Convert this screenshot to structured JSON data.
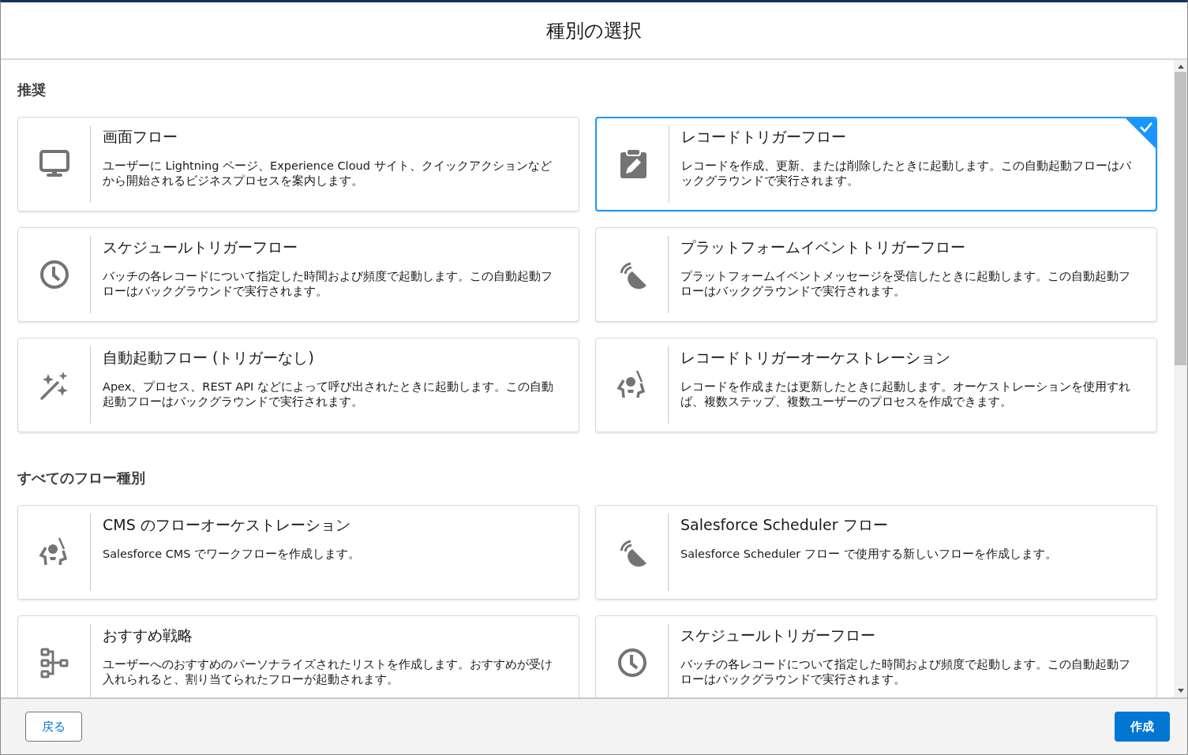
{
  "modal": {
    "title": "種別の選択"
  },
  "sections": [
    {
      "heading": "推奨",
      "cards": [
        {
          "kind": "monitor",
          "title": "画面フロー",
          "description": "ユーザーに Lightning ページ、Experience Cloud サイト、クイックアクションなどから開始されるビジネスプロセスを案内します。",
          "selected": false
        },
        {
          "kind": "clipboard",
          "title": "レコードトリガーフロー",
          "description": "レコードを作成、更新、または削除したときに起動します。この自動起動フローはバックグラウンドで実行されます。",
          "selected": true
        },
        {
          "kind": "clock",
          "title": "スケジュールトリガーフロー",
          "description": "バッチの各レコードについて指定した時間および頻度で起動します。この自動起動フローはバックグラウンドで実行されます。",
          "selected": false
        },
        {
          "kind": "signal",
          "title": "プラットフォームイベントトリガーフロー",
          "description": "プラットフォームイベントメッセージを受信したときに起動します。この自動起動フローはバックグラウンドで実行されます。",
          "selected": false
        },
        {
          "kind": "wand",
          "title": "自動起動フロー (トリガーなし)",
          "description": "Apex、プロセス、REST API などによって呼び出されたときに起動します。この自動起動フローはバックグラウンドで実行されます。",
          "selected": false
        },
        {
          "kind": "conductor",
          "title": "レコードトリガーオーケストレーション",
          "description": "レコードを作成または更新したときに起動します。オーケストレーションを使用すれば、複数ステップ、複数ユーザーのプロセスを作成できます。",
          "selected": false
        }
      ]
    },
    {
      "heading": "すべてのフロー種別",
      "cards": [
        {
          "kind": "conductor",
          "title": "CMS のフローオーケストレーション",
          "description": "Salesforce CMS でワークフローを作成します。",
          "selected": false
        },
        {
          "kind": "signal",
          "title": "Salesforce Scheduler フロー",
          "description": "Salesforce Scheduler フロー で使用する新しいフローを作成します。",
          "selected": false
        },
        {
          "kind": "hierarchy",
          "title": "おすすめ戦略",
          "description": "ユーザーへのおすすめのパーソナライズされたリストを作成します。おすすめが受け入れられると、割り当てられたフローが起動されます。",
          "selected": false
        },
        {
          "kind": "clock",
          "title": "スケジュールトリガーフロー",
          "description": "バッチの各レコードについて指定した時間および頻度で起動します。この自動起動フローはバックグラウンドで実行されます。",
          "selected": false
        }
      ]
    }
  ],
  "footer": {
    "back": "戻る",
    "create": "作成"
  }
}
